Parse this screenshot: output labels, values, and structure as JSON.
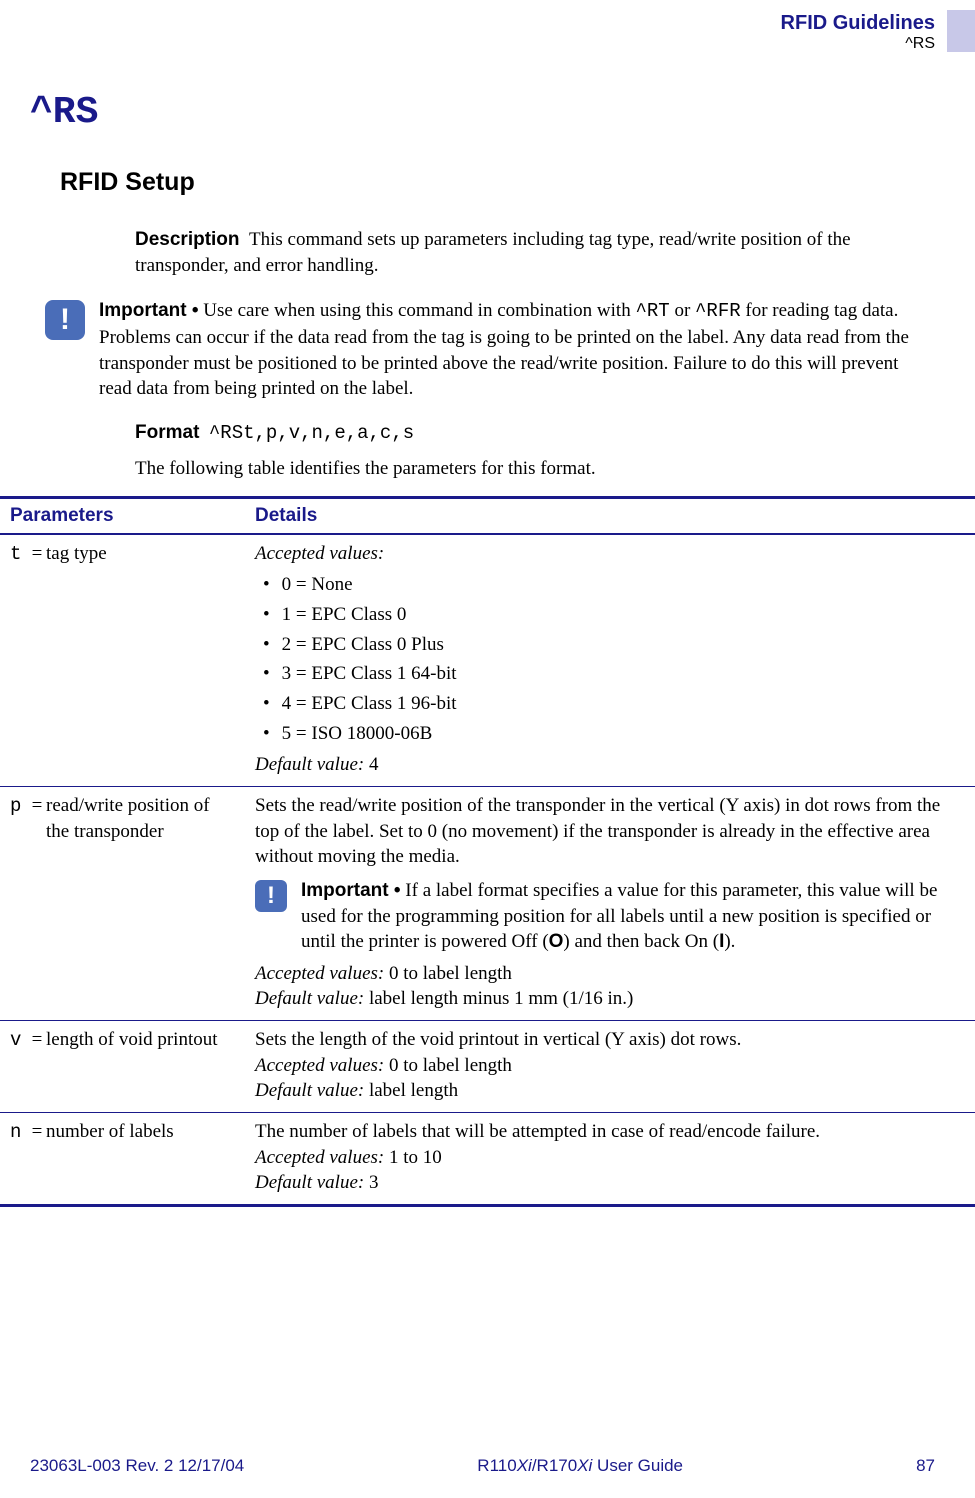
{
  "header": {
    "title": "RFID Guidelines",
    "sub": "^RS"
  },
  "command": "^RS",
  "section": "RFID Setup",
  "description": {
    "label": "Description",
    "text": "This command sets up parameters including tag type, read/write position of the transponder, and error handling."
  },
  "important1": {
    "label": "Important •",
    "pre": "Use care when using this command in combination with ",
    "code1": "^RT",
    "mid": " or ",
    "code2": "^RFR",
    "post": " for reading tag data. Problems can occur if the data read from the tag is going to be printed on the label. Any data read from the transponder must be positioned to be printed above the read/write position. Failure to do this will prevent read data from being printed on the label."
  },
  "format": {
    "label": "Format",
    "code": "^RSt,p,v,n,e,a,c,s"
  },
  "intro": "The following table identifies the parameters for this format.",
  "table": {
    "headers": {
      "p": "Parameters",
      "d": "Details"
    },
    "rows": [
      {
        "code": "t",
        "name": "tag type",
        "accepted_label": "Accepted values:",
        "bullets": [
          "0 = None",
          "1 = EPC Class 0",
          "2 = EPC Class 0 Plus",
          "3 = EPC Class 1 64-bit",
          "4 = EPC Class 1 96-bit",
          "5 = ISO 18000-06B"
        ],
        "default_label": "Default value:",
        "default_val": " 4"
      },
      {
        "code": "p",
        "name": "read/write position of the transponder",
        "desc": "Sets the read/write position of the transponder in the vertical (Y axis) in dot rows from the top of the label. Set to 0 (no movement) if the transponder is already in the effective area without moving the media.",
        "imp_label": "Important •",
        "imp_pre": "If a label format specifies a value for this parameter, this value will be used for the programming position for all labels until a new position is specified or until the printer is powered Off (",
        "imp_o": "O",
        "imp_mid": ") and then back On (",
        "imp_i": "I",
        "imp_post": ").",
        "accepted_label": "Accepted values:",
        "accepted_val": " 0 to label length",
        "default_label": "Default value:",
        "default_val": " label length minus 1 mm (1/16 in.)"
      },
      {
        "code": "v",
        "name": "length of void printout",
        "desc": "Sets the length of the void printout in vertical (Y axis) dot rows.",
        "accepted_label": "Accepted values:",
        "accepted_val": " 0 to label length",
        "default_label": "Default value:",
        "default_val": " label length"
      },
      {
        "code": "n",
        "name": "number of labels",
        "desc": "The number of labels that will be attempted in case of read/encode failure.",
        "accepted_label": "Accepted values:",
        "accepted_val": " 1 to 10",
        "default_label": "Default value:",
        "default_val": " 3"
      }
    ]
  },
  "footer": {
    "left": "23063L-003 Rev. 2    12/17/04",
    "center_a": "R110",
    "center_b": "Xi",
    "center_c": "/R170",
    "center_d": "Xi",
    "center_e": " User Guide",
    "right": "87"
  }
}
